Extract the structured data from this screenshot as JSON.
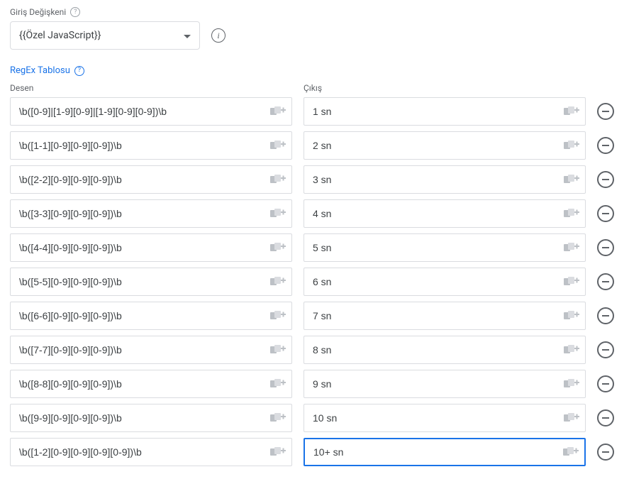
{
  "inputVariable": {
    "label": "Giriş Değişkeni",
    "value": "{{Özel JavaScript}}"
  },
  "regexTable": {
    "label": "RegEx Tablosu",
    "columns": {
      "pattern": "Desen",
      "output": "Çıkış"
    },
    "rows": [
      {
        "pattern": "\\b([0-9]|[1-9][0-9]|[1-9][0-9][0-9])\\b",
        "output": "1 sn",
        "focused": false
      },
      {
        "pattern": "\\b([1-1][0-9][0-9][0-9])\\b",
        "output": "2 sn",
        "focused": false
      },
      {
        "pattern": "\\b([2-2][0-9][0-9][0-9])\\b",
        "output": "3 sn",
        "focused": false
      },
      {
        "pattern": "\\b([3-3][0-9][0-9][0-9])\\b",
        "output": "4 sn",
        "focused": false
      },
      {
        "pattern": "\\b([4-4][0-9][0-9][0-9])\\b",
        "output": "5 sn",
        "focused": false
      },
      {
        "pattern": "\\b([5-5][0-9][0-9][0-9])\\b",
        "output": "6 sn",
        "focused": false
      },
      {
        "pattern": "\\b([6-6][0-9][0-9][0-9])\\b",
        "output": "7 sn",
        "focused": false
      },
      {
        "pattern": "\\b([7-7][0-9][0-9][0-9])\\b",
        "output": "8 sn",
        "focused": false
      },
      {
        "pattern": "\\b([8-8][0-9][0-9][0-9])\\b",
        "output": "9 sn",
        "focused": false
      },
      {
        "pattern": "\\b([9-9][0-9][0-9][0-9])\\b",
        "output": "10 sn",
        "focused": false
      },
      {
        "pattern": "\\b([1-2][0-9][0-9][0-9][0-9])\\b",
        "output": "10+ sn",
        "focused": true
      }
    ]
  }
}
